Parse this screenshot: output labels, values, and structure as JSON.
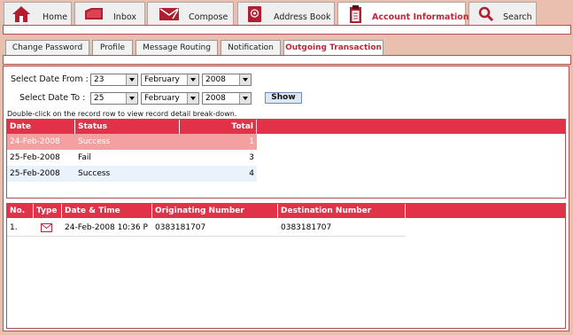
{
  "top_tabs": [
    {
      "label": "Home",
      "icon": "home-icon"
    },
    {
      "label": "Inbox",
      "icon": "inbox-icon"
    },
    {
      "label": "Compose",
      "icon": "compose-icon"
    },
    {
      "label": "Address Book",
      "icon": "address-book-icon"
    },
    {
      "label": "Account Information",
      "icon": "clipboard-icon",
      "active": true
    },
    {
      "label": "Search",
      "icon": "magnifier-icon"
    }
  ],
  "sub_tabs": [
    {
      "label": "Change Password"
    },
    {
      "label": "Profile"
    },
    {
      "label": "Message Routing"
    },
    {
      "label": "Notification"
    },
    {
      "label": "Outgoing Transaction",
      "active": true
    }
  ],
  "filter": {
    "from_label": "Select Date From :",
    "to_label": "Select Date To :",
    "from_day": "23",
    "from_month": "February",
    "from_year": "2008",
    "to_day": "25",
    "to_month": "February",
    "to_year": "2008",
    "show_label": "Show",
    "hint": "Double-click on the record row to view record detail break-down."
  },
  "summary_table": {
    "headers": [
      "Date",
      "Status",
      "Total"
    ],
    "rows": [
      {
        "date": "24-Feb-2008",
        "status": "Success",
        "total": "1"
      },
      {
        "date": "25-Feb-2008",
        "status": "Fail",
        "total": "3"
      },
      {
        "date": "25-Feb-2008",
        "status": "Success",
        "total": "4"
      }
    ]
  },
  "detail_table": {
    "headers": [
      "No.",
      "Type",
      "Date & Time",
      "Originating Number",
      "Destination Number"
    ],
    "rows": [
      {
        "no": "1.",
        "type_icon": "envelope-icon",
        "datetime": "24-Feb-2008 10:36 P",
        "orig": "0383181707",
        "dest": "0383181707"
      }
    ]
  },
  "colors": {
    "accent": "#e0334a",
    "selected_row": "#f4a0a0",
    "alt_row": "#eaf2fb",
    "background": "#e9bfb0"
  }
}
